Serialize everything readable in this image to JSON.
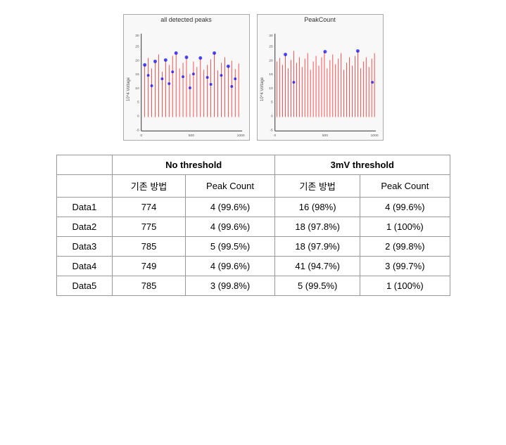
{
  "charts": [
    {
      "title": "all detected peaks",
      "id": "chart-all-peaks"
    },
    {
      "title": "PeakCount",
      "id": "chart-peak-count"
    }
  ],
  "table": {
    "col_groups": [
      {
        "label": "",
        "colspan": 1
      },
      {
        "label": "No threshold",
        "colspan": 2
      },
      {
        "label": "3mV threshold",
        "colspan": 2
      }
    ],
    "sub_headers": [
      "",
      "기존 방법",
      "Peak Count",
      "기존 방법",
      "Peak Count"
    ],
    "rows": [
      {
        "label": "Data1",
        "values": [
          "774",
          "4 (99.6%)",
          "16 (98%)",
          "4 (99.6%)"
        ]
      },
      {
        "label": "Data2",
        "values": [
          "775",
          "4 (99.6%)",
          "18 (97.8%)",
          "1 (100%)"
        ]
      },
      {
        "label": "Data3",
        "values": [
          "785",
          "5 (99.5%)",
          "18 (97.9%)",
          "2 (99.8%)"
        ]
      },
      {
        "label": "Data4",
        "values": [
          "749",
          "4 (99.6%)",
          "41 (94.7%)",
          "3 (99.7%)"
        ]
      },
      {
        "label": "Data5",
        "values": [
          "785",
          "3 (99.8%)",
          "5 (99.5%)",
          "1 (100%)"
        ]
      }
    ]
  }
}
